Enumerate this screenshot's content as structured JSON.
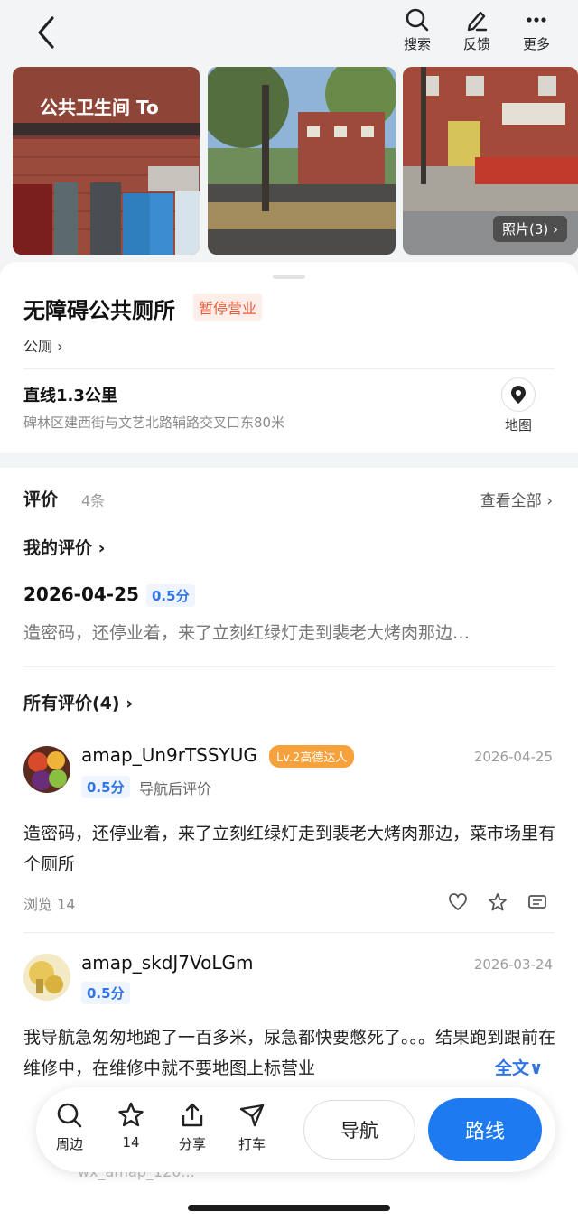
{
  "topbar": {
    "tools": [
      {
        "label": "搜索",
        "icon": "search-icon"
      },
      {
        "label": "反馈",
        "icon": "edit-icon"
      },
      {
        "label": "更多",
        "icon": "more-icon"
      }
    ]
  },
  "photos": {
    "badge": "照片(3) ›",
    "sign_text": "公共卫生间 To"
  },
  "place": {
    "title": "无障碍公共厕所",
    "status": "暂停营业",
    "category": "公厕 ›",
    "distance": "直线1.3公里",
    "address": "碑林区建西街与文艺北路辅路交叉口东80米",
    "map_label": "地图"
  },
  "reviews": {
    "title": "评价",
    "count": "4条",
    "view_all": "查看全部 ›",
    "mine": {
      "header": "我的评价 ›",
      "date": "2026-04-25",
      "score": "0.5分",
      "text": "造密码，还停业着，来了立刻红绿灯走到裴老大烤肉那边…"
    },
    "all_header": "所有评价(4) ›",
    "items": [
      {
        "user": "amap_Un9rTSSYUG",
        "level": "Lv.2高德达人",
        "date": "2026-04-25",
        "score": "0.5分",
        "tag": "导航后评价",
        "text": "造密码，还停业着，来了立刻红绿灯走到裴老大烤肉那边，菜市场里有个厕所",
        "views": "浏览 14"
      },
      {
        "user": "amap_skdJ7VoLGm",
        "date": "2026-03-24",
        "score": "0.5分",
        "text": "我导航急匆匆地跑了一百多米，尿急都快要憋死了。。。结果跑到跟前在维修中，在维修中就不要地图上标营业",
        "full": "全文∨"
      }
    ],
    "ghost_text": "wx_amap_120..."
  },
  "bottom": {
    "items": [
      {
        "label": "周边",
        "icon": "search-icon"
      },
      {
        "label": "14",
        "icon": "star-icon"
      },
      {
        "label": "分享",
        "icon": "share-icon"
      },
      {
        "label": "打车",
        "icon": "taxi-icon"
      }
    ],
    "nav": "导航",
    "route": "路线"
  }
}
